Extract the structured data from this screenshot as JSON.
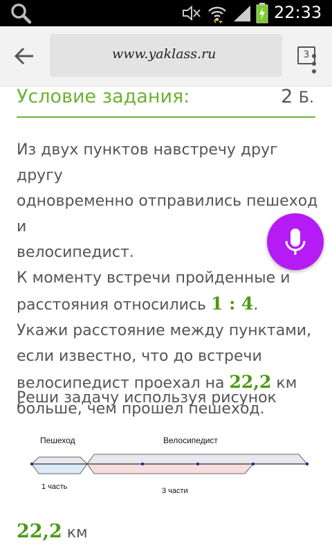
{
  "status_bar": {
    "time": "22:33",
    "icons": [
      "search-icon",
      "mute-icon",
      "wifi-icon",
      "signal-icon",
      "battery-icon"
    ]
  },
  "browser": {
    "url": "www.yaklass.ru",
    "tab_count": "3"
  },
  "task": {
    "heading": "Условие задания:",
    "points_value": "2",
    "points_unit": "Б.",
    "line1": "Из двух пунктов навстречу друг другу",
    "line2": "одновременно отправились пешеход и",
    "line3": "велосипедист.",
    "line4": "К моменту встречи пройденные и",
    "line5_text": "расстояния относились ",
    "ratio": "1 : 4",
    "line5_end": ".",
    "line6": "Укажи расстояние между пунктами,",
    "line7": "если известно, что до встречи",
    "line8_text": "велосипедист проехал на ",
    "difference": "22,2",
    "line8_unit": " км",
    "line9": "больше, чем прошел пешеход."
  },
  "instruction": "Реши задачу используя рисунок",
  "diagram": {
    "label_pedestrian": "Пешеход",
    "label_cyclist": "Велосипедист",
    "label_one_part": "1 часть",
    "label_three_parts": "3 части",
    "colors": {
      "pedestrian_fill": "#dbeaf5",
      "cyclist_fill": "#f6dede",
      "top_fill": "#e8e8ee",
      "dot": "#2222aa"
    }
  },
  "answer": {
    "value": "22,2",
    "unit": "км"
  },
  "colors": {
    "accent_green": "#6bb233",
    "number_green": "#4b9a12",
    "fab_purple": "#b51bf5"
  }
}
